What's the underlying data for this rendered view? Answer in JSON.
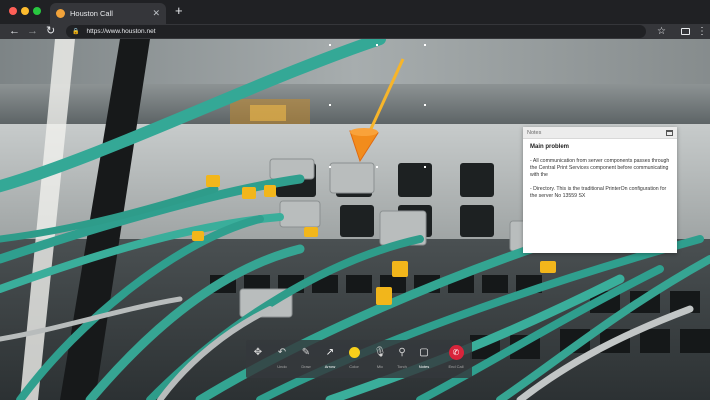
{
  "browser": {
    "tab_title": "Houston Call",
    "tab_close": "✕",
    "new_tab": "+",
    "url": "https://www.houston.net"
  },
  "notes": {
    "title": "Notes",
    "heading": "Main problem",
    "lines": [
      "- All communication from server components passes through the Central Print Services component before communicating with the",
      "- Directory. This is the traditional PrinterOn configuration for the server No 13559 SX"
    ]
  },
  "toolbar": {
    "tools": [
      {
        "label": "",
        "icon": "move-icon"
      },
      {
        "label": "Undo",
        "icon": "undo-icon"
      },
      {
        "label": "Draw",
        "icon": "pencil-icon"
      },
      {
        "label": "Arrow",
        "icon": "arrow-icon",
        "active": true
      },
      {
        "label": "Color",
        "icon": "color-icon"
      },
      {
        "label": "Mic",
        "icon": "mic-off-icon"
      },
      {
        "label": "Torch",
        "icon": "torch-icon"
      },
      {
        "label": "Notes",
        "icon": "notes-icon",
        "active": true
      },
      {
        "label": "End Call",
        "icon": "end-call-icon"
      }
    ]
  },
  "colors": {
    "annotation_arrow": "#f28c1c",
    "selected_color": "#f7d01b",
    "end_call": "#d8243b",
    "cable": "#2f9f8e"
  }
}
